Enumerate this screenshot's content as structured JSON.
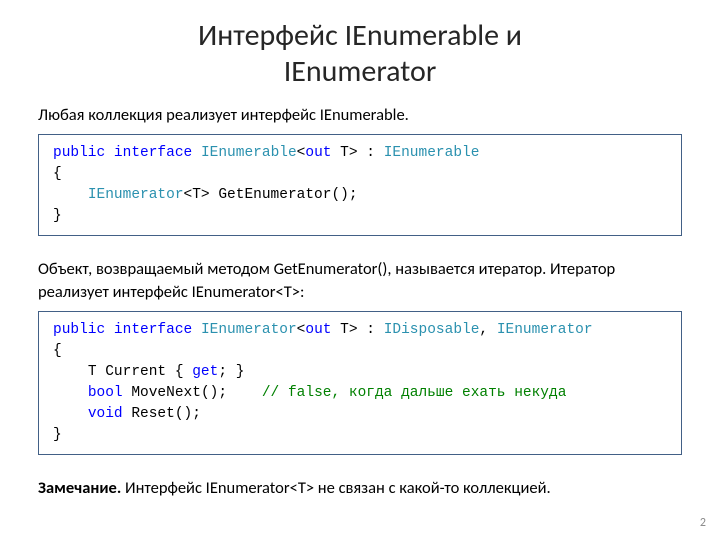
{
  "title_line1": "Интерфейс IEnumerable и",
  "title_line2": "IEnumerator",
  "para1": "Любая коллекция реализует интерфейс IEnumerable.",
  "code1": {
    "l1_kw1": "public",
    "l1_sp1": " ",
    "l1_kw2": "interface",
    "l1_sp2": " ",
    "l1_t1": "IEnumerable",
    "l1_a1": "<",
    "l1_kw3": "out",
    "l1_a2": " T> : ",
    "l1_t2": "IEnumerable",
    "l2": "{",
    "l3_ind": "    ",
    "l3_t1": "IEnumerator",
    "l3_rest": "<T> GetEnumerator();",
    "l4": "}"
  },
  "para2": "Объект, возвращаемый методом GetEnumerator(),  называется итератор.  Итератор  реализует  интерфейс IEnumerator<T>:",
  "code2": {
    "l1_kw1": "public",
    "l1_sp1": " ",
    "l1_kw2": "interface",
    "l1_sp2": " ",
    "l1_t1": "IEnumerator",
    "l1_a1": "<",
    "l1_kw3": "out",
    "l1_a2": " T> : ",
    "l1_t2": "IDisposable",
    "l1_a3": ", ",
    "l1_t3": "IEnumerator",
    "l2": "{",
    "l3_ind": "    ",
    "l3_a": "T Current { ",
    "l3_kw": "get",
    "l3_b": "; }",
    "l4_ind": "    ",
    "l4_kw": "bool",
    "l4_a": " MoveNext();    ",
    "l4_cmt": "// false, когда дальше ехать некуда",
    "l5_ind": "    ",
    "l5_kw": "void",
    "l5_a": " Reset();",
    "l6": "}"
  },
  "para3_bold": "Замечание.",
  "para3_rest": " Интерфейс IEnumerator<T> не связан с какой-то коллекцией.",
  "page_number": "2"
}
